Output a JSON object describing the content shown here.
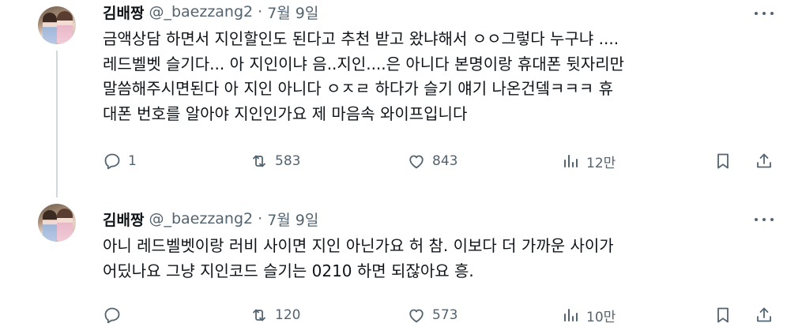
{
  "tweets": [
    {
      "author": {
        "name": "김배짱",
        "handle": "@_baezzang2"
      },
      "separator": "·",
      "date": "7월 9일",
      "text": "금액상담 하면서 지인할인도 된다고 추천 받고 왔냐해서 ㅇㅇ그렇다 누구냐 ....\n레드벨벳 슬기다... 아 지인이냐 음..지인....은 아니다 본명이랑 휴대폰 뒷자리만\n말씀해주시면된다 아 지인 아니다 ㅇㅈㄹ 하다가 슬기 얘기 나온건뎈ㅋㅋㅋ 휴\n대폰 번호를 알아야 지인인가요 제 마음속 와이프입니다",
      "replies": "1",
      "retweets": "583",
      "likes": "843",
      "views": "12만"
    },
    {
      "author": {
        "name": "김배짱",
        "handle": "@_baezzang2"
      },
      "separator": "·",
      "date": "7월 9일",
      "text": "아니 레드벨벳이랑 러비 사이면 지인 아닌가요 허 참. 이보다 더 가까운 사이가\n어딨나요 그냥 지인코드 슬기는 0210 하면 되잖아요 흥.",
      "replies": "",
      "retweets": "120",
      "likes": "573",
      "views": "10만"
    }
  ],
  "icons": {
    "reply": "reply-icon",
    "retweet": "retweet-icon",
    "like": "heart-icon",
    "views": "views-icon",
    "bookmark": "bookmark-icon",
    "share": "share-icon",
    "more": "more-icon"
  },
  "colors": {
    "text_primary": "#0f1419",
    "text_secondary": "#536471",
    "thread_line": "#cfd9de",
    "background": "#ffffff"
  }
}
